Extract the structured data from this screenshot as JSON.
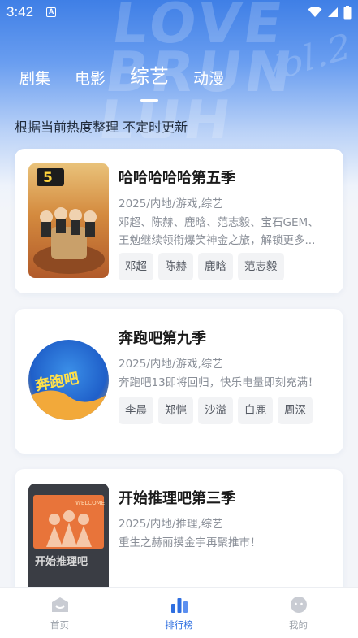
{
  "status_bar": {
    "time": "3:42",
    "notification_badge": "A"
  },
  "hero_decoration_text": [
    "LOVE",
    "BRUN",
    "LUH"
  ],
  "hero_decoration_script": "Vol.2",
  "tabs": [
    {
      "label": "剧集",
      "active": false
    },
    {
      "label": "电影",
      "active": false
    },
    {
      "label": "综艺",
      "active": true
    },
    {
      "label": "动漫",
      "active": false
    }
  ],
  "subtitle": "根据当前热度整理 不定时更新",
  "items": [
    {
      "title": "哈哈哈哈哈第五季",
      "meta": "2025/内地/游戏,综艺",
      "description": "邓超、陈赫、鹿晗、范志毅、宝石GEM、王勉继续领衔爆笑神金之旅，解锁更多...",
      "tags": [
        "邓超",
        "陈赫",
        "鹿晗",
        "范志毅"
      ],
      "poster_text": "5"
    },
    {
      "title": "奔跑吧第九季",
      "meta": "2025/内地/游戏,综艺",
      "description": "奔跑吧13即将回归，快乐电量即刻充满！",
      "tags": [
        "李晨",
        "郑恺",
        "沙溢",
        "白鹿",
        "周深"
      ],
      "poster_text": "奔跑吧"
    },
    {
      "title": "开始推理吧第三季",
      "meta": "2025/内地/推理,综艺",
      "description": "重生之赫丽摸金宇再聚推市！",
      "tags": [],
      "poster_text": "开始推理吧",
      "poster_subtext": "WELCOME"
    }
  ],
  "bottom_nav": [
    {
      "label": "首页",
      "icon": "home-icon",
      "active": false
    },
    {
      "label": "排行榜",
      "icon": "ranking-icon",
      "active": true
    },
    {
      "label": "我的",
      "icon": "profile-icon",
      "active": false
    }
  ],
  "colors": {
    "accent": "#2f6fe0",
    "header_blue": "#3f7fe6"
  }
}
